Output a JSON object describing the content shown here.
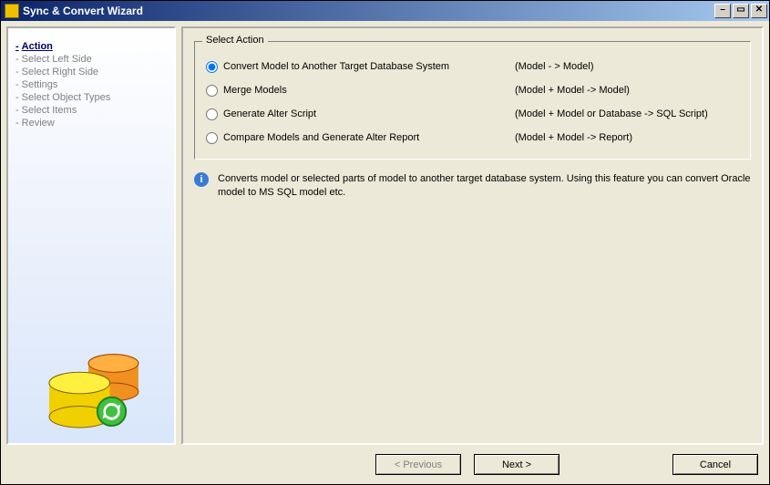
{
  "window": {
    "title": "Sync & Convert Wizard"
  },
  "nav": {
    "items": [
      {
        "label": "Action",
        "active": true
      },
      {
        "label": "Select Left Side",
        "active": false
      },
      {
        "label": "Select Right Side",
        "active": false
      },
      {
        "label": "Settings",
        "active": false
      },
      {
        "label": "Select Object Types",
        "active": false
      },
      {
        "label": "Select Items",
        "active": false
      },
      {
        "label": "Review",
        "active": false
      }
    ]
  },
  "groupbox": {
    "legend": "Select Action",
    "options": [
      {
        "label": "Convert Model to Another Target Database System",
        "desc": "(Model - > Model)",
        "selected": true
      },
      {
        "label": "Merge Models",
        "desc": "(Model + Model -> Model)",
        "selected": false
      },
      {
        "label": "Generate Alter Script",
        "desc": "(Model + Model or Database -> SQL Script)",
        "selected": false
      },
      {
        "label": "Compare Models and Generate Alter Report",
        "desc": "(Model + Model -> Report)",
        "selected": false
      }
    ]
  },
  "info": {
    "text": "Converts model or selected parts of model to another target database system. Using this feature you can convert Oracle model to MS SQL model etc."
  },
  "buttons": {
    "previous": "< Previous",
    "next": "Next >",
    "cancel": "Cancel"
  }
}
